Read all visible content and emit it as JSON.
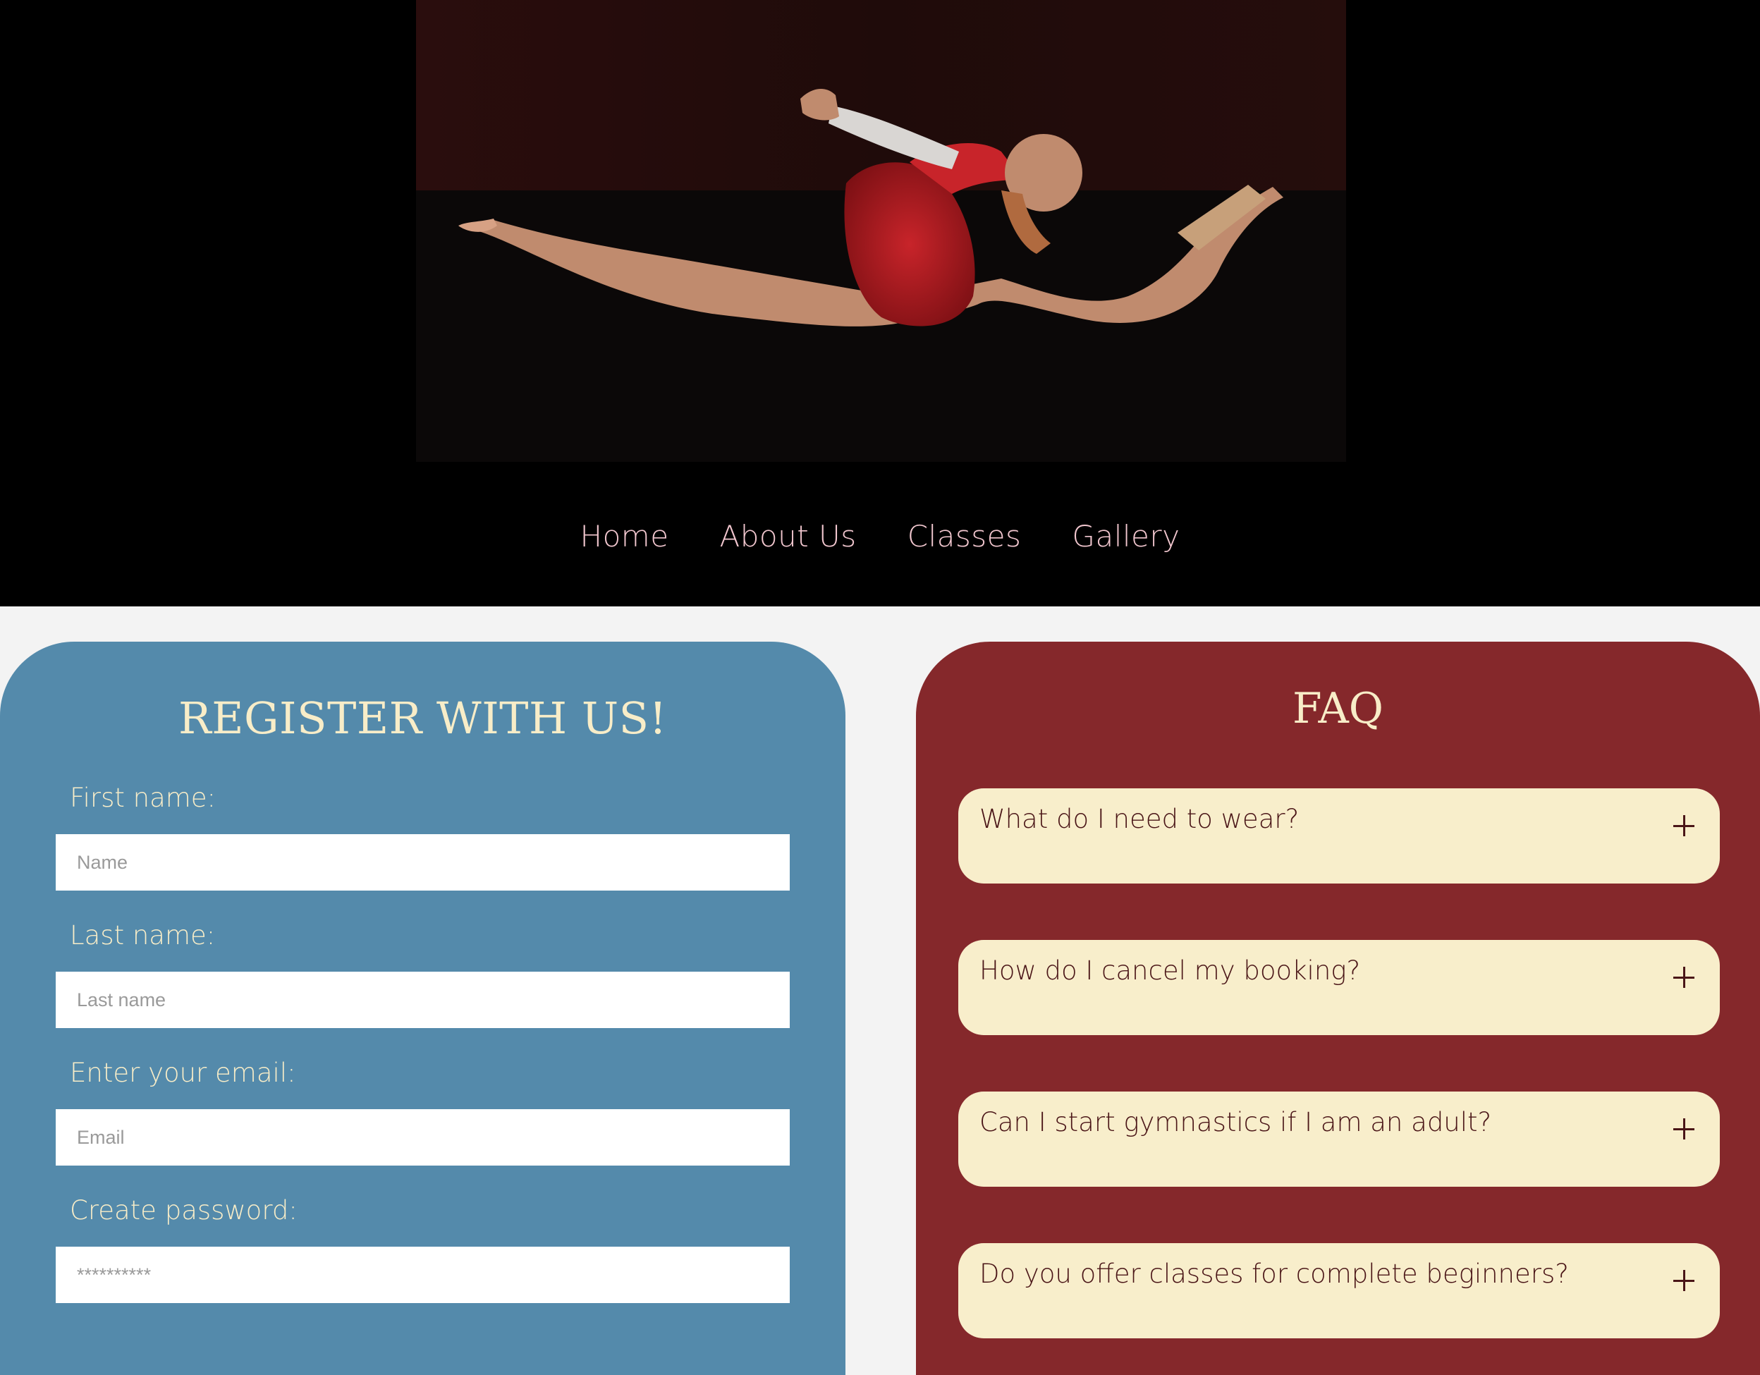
{
  "hero": {
    "image": "gymnast-split-leap-photo"
  },
  "nav": {
    "items": [
      {
        "label": "Home"
      },
      {
        "label": "About Us"
      },
      {
        "label": "Classes"
      },
      {
        "label": "Gallery"
      }
    ]
  },
  "register": {
    "title": "REGISTER WITH US!",
    "first_name": {
      "label": "First name:",
      "placeholder": "Name",
      "value": ""
    },
    "last_name": {
      "label": "Last name:",
      "placeholder": "Last name",
      "value": ""
    },
    "email": {
      "label": "Enter your email:",
      "placeholder": "Email",
      "value": ""
    },
    "password": {
      "label": "Create password:",
      "placeholder": "**********",
      "value": ""
    }
  },
  "faq": {
    "title": "FAQ",
    "items": [
      {
        "question": "What do I need to wear?",
        "icon": "plus-icon"
      },
      {
        "question": "How do I cancel my booking?",
        "icon": "plus-icon"
      },
      {
        "question": "Can I start gymnastics if I am an adult?",
        "icon": "plus-icon"
      },
      {
        "question": "Do you offer classes for complete beginners?",
        "icon": "plus-icon"
      }
    ]
  },
  "colors": {
    "header_bg": "#000000",
    "nav_text": "#f2c7cf",
    "page_bg": "#f3f3f3",
    "register_bg": "#548aab",
    "faq_bg": "#85282b",
    "cream": "#f8edc8",
    "faq_text": "#4a1517"
  }
}
